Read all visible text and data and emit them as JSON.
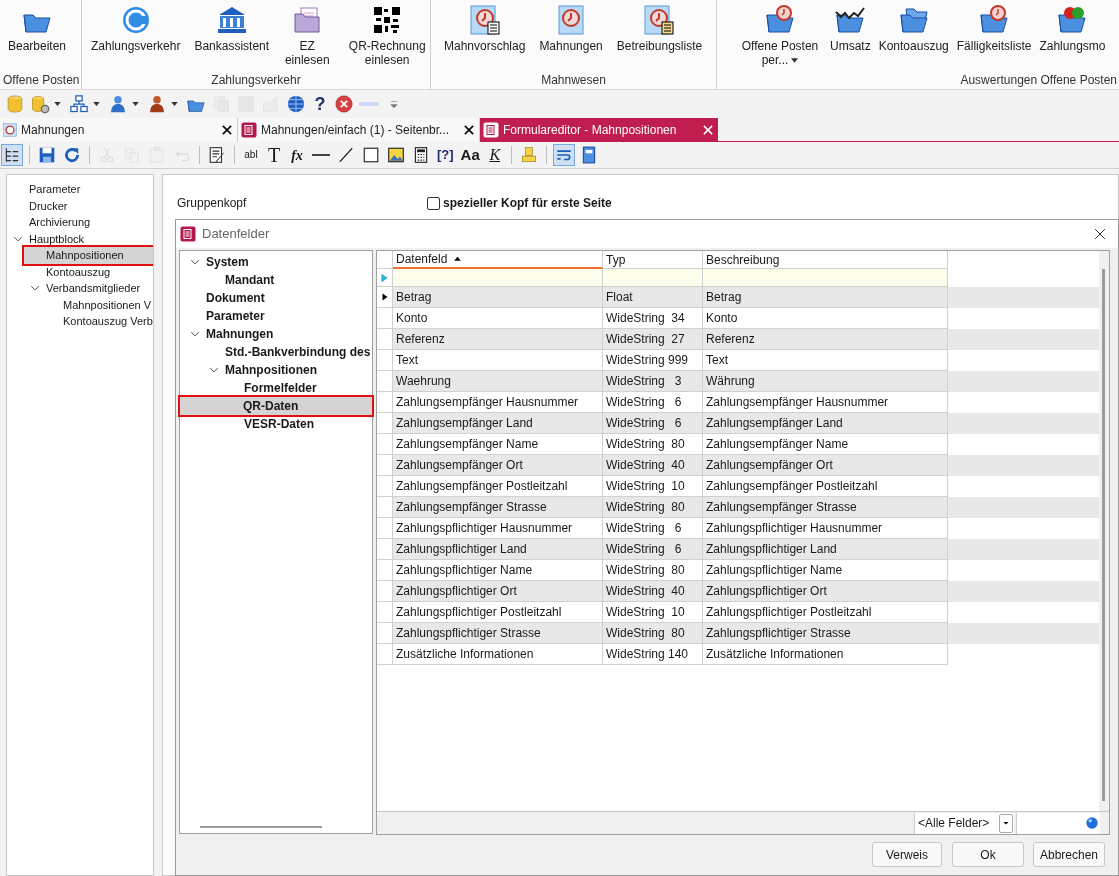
{
  "ribbon": {
    "groups": [
      {
        "label": "Offene Posten",
        "items": [
          {
            "label": "Bearbeiten",
            "kind": "folder",
            "dropdown": false
          }
        ]
      },
      {
        "label": "Zahlungsverkehr",
        "items": [
          {
            "label": "Zahlungsverkehr",
            "kind": "coin",
            "dropdown": false
          },
          {
            "label": "Bankassistent",
            "kind": "bank",
            "dropdown": false
          },
          {
            "label": "EZ einlesen",
            "kind": "folder-pages",
            "dropdown": false
          },
          {
            "label": "QR-Rechnung einlesen",
            "kind": "qr",
            "dropdown": false
          }
        ]
      },
      {
        "label": "Mahnwesen",
        "items": [
          {
            "label": "Mahnvorschlag",
            "kind": "clock-doc",
            "dropdown": false
          },
          {
            "label": "Mahnungen",
            "kind": "clock",
            "dropdown": false
          },
          {
            "label": "Betreibungsliste",
            "kind": "clock-list",
            "dropdown": false
          }
        ]
      },
      {
        "label": "Auswertungen Offene Posten",
        "items": [
          {
            "label": "Offene Posten per...",
            "kind": "folder-clock",
            "dropdown": true
          },
          {
            "label": "Umsatz",
            "kind": "folder-chart",
            "dropdown": false
          },
          {
            "label": "Kontoauszug",
            "kind": "folders",
            "dropdown": false
          },
          {
            "label": "Fälligkeitsliste",
            "kind": "folder-clock",
            "dropdown": false
          },
          {
            "label": "Zahlungsmo",
            "kind": "folder-coin",
            "dropdown": false
          }
        ]
      }
    ]
  },
  "quick_toolbar": [
    {
      "kind": "database",
      "dropdown": false,
      "disabled": false
    },
    {
      "kind": "database-gear",
      "dropdown": true,
      "disabled": false
    },
    {
      "kind": "network",
      "dropdown": true,
      "disabled": false
    },
    {
      "kind": "person",
      "dropdown": true,
      "disabled": false
    },
    {
      "kind": "person-red",
      "dropdown": true,
      "disabled": false
    },
    {
      "kind": "folder",
      "dropdown": false,
      "disabled": false
    },
    {
      "kind": "pages",
      "dropdown": false,
      "disabled": true
    },
    {
      "kind": "square",
      "dropdown": false,
      "disabled": true
    },
    {
      "kind": "mail",
      "dropdown": false,
      "disabled": true
    },
    {
      "kind": "globe",
      "dropdown": false,
      "disabled": false
    },
    {
      "kind": "glyph",
      "text": "?",
      "dropdown": false,
      "disabled": false
    },
    {
      "kind": "stop",
      "dropdown": false,
      "disabled": false
    },
    {
      "kind": "dash",
      "dropdown": false,
      "disabled": false
    },
    {
      "kind": "overflow",
      "dropdown": false,
      "disabled": false
    }
  ],
  "tabs": [
    {
      "label": "Mahnungen",
      "kind": "clock",
      "selected": false
    },
    {
      "label": "Mahnungen/einfach (1) - Seitenbr...",
      "kind": "form",
      "selected": false
    },
    {
      "label": "Formulareditor - Mahnpositionen",
      "kind": "form",
      "selected": true
    }
  ],
  "editor_toolbar": [
    {
      "kind": "tree",
      "pressed": true,
      "disabled": false
    },
    {
      "kind": "separator"
    },
    {
      "kind": "save",
      "pressed": false,
      "disabled": false
    },
    {
      "kind": "refresh",
      "pressed": false,
      "disabled": false
    },
    {
      "kind": "separator"
    },
    {
      "kind": "cut",
      "pressed": false,
      "disabled": true
    },
    {
      "kind": "copy",
      "pressed": false,
      "disabled": true
    },
    {
      "kind": "paste",
      "pressed": false,
      "disabled": true
    },
    {
      "kind": "undo",
      "pressed": false,
      "disabled": true
    },
    {
      "kind": "separator"
    },
    {
      "kind": "edit",
      "pressed": false,
      "disabled": false
    },
    {
      "kind": "separator"
    },
    {
      "kind": "glyph-box",
      "text": "abl",
      "pressed": false,
      "disabled": false
    },
    {
      "kind": "glyph-serif",
      "text": "T",
      "pressed": false,
      "disabled": false
    },
    {
      "kind": "glyph-italic",
      "text": "fx",
      "pressed": false,
      "disabled": false
    },
    {
      "kind": "hline",
      "pressed": false,
      "disabled": false
    },
    {
      "kind": "dline",
      "pressed": false,
      "disabled": false
    },
    {
      "kind": "rect",
      "pressed": false,
      "disabled": false
    },
    {
      "kind": "image",
      "pressed": false,
      "disabled": false
    },
    {
      "kind": "calc",
      "pressed": false,
      "disabled": false
    },
    {
      "kind": "glyph",
      "text": "[?]",
      "pressed": false,
      "disabled": false
    },
    {
      "kind": "glyph-bold",
      "text": "Aa",
      "pressed": false,
      "disabled": false
    },
    {
      "kind": "glyph-underline",
      "text": "K",
      "pressed": false,
      "disabled": false
    },
    {
      "kind": "separator"
    },
    {
      "kind": "stamp",
      "pressed": false,
      "disabled": false
    },
    {
      "kind": "separator"
    },
    {
      "kind": "wrap",
      "pressed": true,
      "disabled": false
    },
    {
      "kind": "book",
      "pressed": false,
      "disabled": false
    }
  ],
  "structure_tree": [
    {
      "label": "Parameter",
      "selected": false
    },
    {
      "label": "Drucker",
      "selected": false
    },
    {
      "label": "Archivierung",
      "selected": false
    },
    {
      "label": "Hauptblock",
      "selected": false,
      "expanded": true,
      "children": [
        {
          "label": "Mahnpositionen",
          "selected": true
        },
        {
          "label": "Kontoauszug",
          "selected": false
        },
        {
          "label": "Verbandsmitglieder",
          "selected": false,
          "expanded": true,
          "children": [
            {
              "label": "Mahnpositionen V",
              "selected": false
            },
            {
              "label": "Kontoauszug Verb",
              "selected": false
            }
          ]
        }
      ]
    }
  ],
  "editor": {
    "section_label": "Gruppenkopf",
    "first_page_header": {
      "label": "spezieller Kopf für erste Seite",
      "checked": false
    }
  },
  "dialog": {
    "title": "Datenfelder",
    "tree": [
      {
        "label": "System",
        "selected": false,
        "expanded": true,
        "children": [
          {
            "label": "Mandant",
            "selected": false
          }
        ]
      },
      {
        "label": "Dokument",
        "selected": false
      },
      {
        "label": "Parameter",
        "selected": false
      },
      {
        "label": "Mahnungen",
        "selected": false,
        "expanded": true,
        "children": [
          {
            "label": "Std.-Bankverbindung des",
            "selected": false
          },
          {
            "label": "Mahnpositionen",
            "selected": false,
            "expanded": true,
            "children": [
              {
                "label": "Formelfelder",
                "selected": false
              },
              {
                "label": "QR-Daten",
                "selected": true
              },
              {
                "label": "VESR-Daten",
                "selected": false
              }
            ]
          }
        ]
      }
    ],
    "table": {
      "columns": [
        {
          "label": "Datenfeld",
          "sorted": true
        },
        {
          "label": "Typ",
          "sorted": false
        },
        {
          "label": "Beschreibung",
          "sorted": false
        }
      ],
      "rows": [
        {
          "cells": [
            "Betrag",
            "Float",
            "Betrag"
          ],
          "current": true
        },
        {
          "cells": [
            "Konto",
            "WideString  34",
            "Konto"
          ],
          "current": false
        },
        {
          "cells": [
            "Referenz",
            "WideString  27",
            "Referenz"
          ],
          "current": false
        },
        {
          "cells": [
            "Text",
            "WideString 999",
            "Text"
          ],
          "current": false
        },
        {
          "cells": [
            "Waehrung",
            "WideString   3",
            "Währung"
          ],
          "current": false
        },
        {
          "cells": [
            "Zahlungsempfänger Hausnummer",
            "WideString   6",
            "Zahlungsempfänger Hausnummer"
          ],
          "current": false
        },
        {
          "cells": [
            "Zahlungsempfänger Land",
            "WideString   6",
            "Zahlungsempfänger Land"
          ],
          "current": false
        },
        {
          "cells": [
            "Zahlungsempfänger Name",
            "WideString  80",
            "Zahlungsempfänger Name"
          ],
          "current": false
        },
        {
          "cells": [
            "Zahlungsempfänger Ort",
            "WideString  40",
            "Zahlungsempfänger Ort"
          ],
          "current": false
        },
        {
          "cells": [
            "Zahlungsempfänger Postleitzahl",
            "WideString  10",
            "Zahlungsempfänger Postleitzahl"
          ],
          "current": false
        },
        {
          "cells": [
            "Zahlungsempfänger Strasse",
            "WideString  80",
            "Zahlungsempfänger Strasse"
          ],
          "current": false
        },
        {
          "cells": [
            "Zahlungspflichtiger Hausnummer",
            "WideString   6",
            "Zahlungspflichtiger Hausnummer"
          ],
          "current": false
        },
        {
          "cells": [
            "Zahlungspflichtiger Land",
            "WideString   6",
            "Zahlungspflichtiger Land"
          ],
          "current": false
        },
        {
          "cells": [
            "Zahlungspflichtiger Name",
            "WideString  80",
            "Zahlungspflichtiger Name"
          ],
          "current": false
        },
        {
          "cells": [
            "Zahlungspflichtiger Ort",
            "WideString  40",
            "Zahlungspflichtiger Ort"
          ],
          "current": false
        },
        {
          "cells": [
            "Zahlungspflichtiger Postleitzahl",
            "WideString  10",
            "Zahlungspflichtiger Postleitzahl"
          ],
          "current": false
        },
        {
          "cells": [
            "Zahlungspflichtiger Strasse",
            "WideString  80",
            "Zahlungspflichtiger Strasse"
          ],
          "current": false
        },
        {
          "cells": [
            "Zusätzliche Informationen",
            "WideString 140",
            "Zusätzliche Informationen"
          ],
          "current": false
        }
      ]
    },
    "field_filter": {
      "value": "<Alle Felder>"
    },
    "buttons": [
      "Verweis",
      "Ok",
      "Abbrechen"
    ]
  }
}
